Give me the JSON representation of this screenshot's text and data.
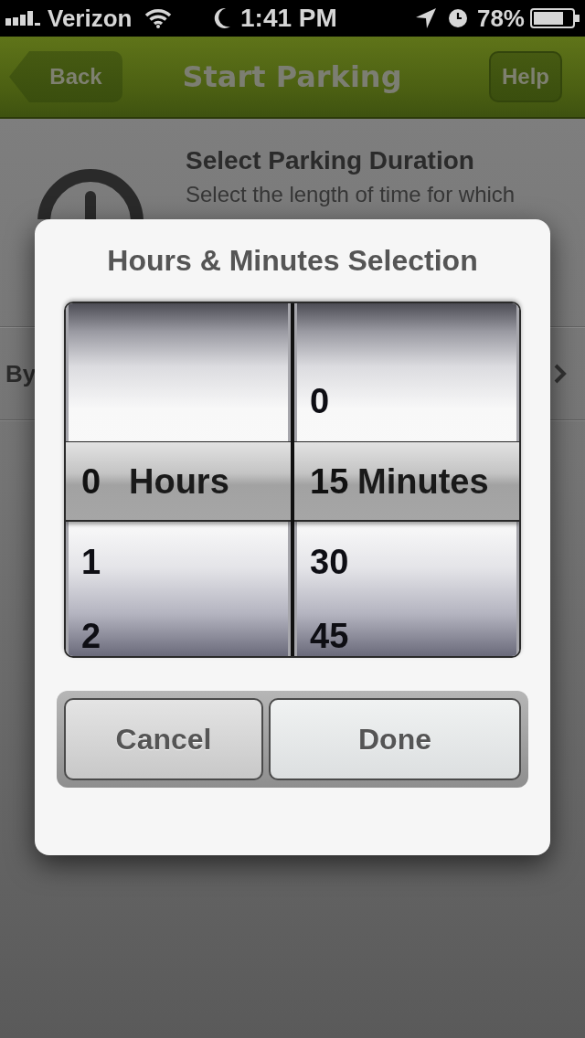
{
  "status_bar": {
    "carrier": "Verizon",
    "time": "1:41 PM",
    "battery": "78%"
  },
  "nav_bar": {
    "back": "Back",
    "title": "Start Parking",
    "help": "Help"
  },
  "section": {
    "title": "Select Parking Duration",
    "description": "Select the length of time for which"
  },
  "option_row": {
    "label": "By"
  },
  "dialog": {
    "title": "Hours & Minutes Selection",
    "wheels": [
      {
        "unit": "Hours",
        "items": [
          {
            "label": "0",
            "selected": true
          },
          {
            "label": "1",
            "selected": false
          },
          {
            "label": "2",
            "selected": false
          }
        ]
      },
      {
        "unit": "Minutes",
        "items": [
          {
            "label": "0",
            "selected": false
          },
          {
            "label": "15",
            "selected": true
          },
          {
            "label": "30",
            "selected": false
          },
          {
            "label": "45",
            "selected": false
          }
        ]
      }
    ],
    "buttons": [
      {
        "label": "Cancel",
        "kind": "cancel"
      },
      {
        "label": "Done",
        "kind": "confirm"
      }
    ]
  }
}
